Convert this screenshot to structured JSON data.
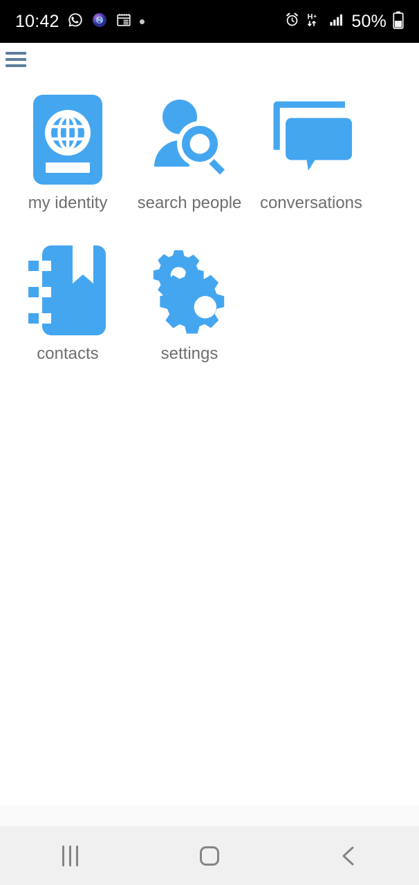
{
  "status_bar": {
    "time": "10:42",
    "battery_percent": "50%",
    "left_icons": [
      {
        "name": "whatsapp-icon",
        "label": "WhatsApp"
      },
      {
        "name": "app-notification-icon",
        "label": "App"
      },
      {
        "name": "calendar-icon",
        "label": "Calendar"
      },
      {
        "name": "notification-dot-icon",
        "label": "Notification"
      }
    ],
    "right_icons": [
      {
        "name": "alarm-clock-icon",
        "label": "Alarm"
      },
      {
        "name": "mobile-data-hplus-icon",
        "label": "H+"
      },
      {
        "name": "signal-bars-icon",
        "label": "Signal"
      },
      {
        "name": "battery-icon",
        "label": "Battery"
      }
    ],
    "background_color": "#000000",
    "text_color": "#ffffff"
  },
  "app_bar": {
    "menu_icon_name": "hamburger-menu-icon",
    "menu_color": "#5d7e9c"
  },
  "theme": {
    "accent_blue": "#45a6f0",
    "label_gray": "#6e6e6e",
    "page_background": "#ffffff",
    "nav_background": "#f0f0f0"
  },
  "grid": {
    "tiles": [
      {
        "id": "my-identity",
        "label": "my identity",
        "icon": "passport-globe-icon"
      },
      {
        "id": "search-people",
        "label": "search people",
        "icon": "person-search-icon"
      },
      {
        "id": "conversations",
        "label": "conversations",
        "icon": "chat-bubbles-icon"
      },
      {
        "id": "contacts",
        "label": "contacts",
        "icon": "address-book-icon"
      },
      {
        "id": "settings",
        "label": "settings",
        "icon": "gears-icon"
      }
    ]
  },
  "nav_bar": {
    "buttons": [
      {
        "id": "recents",
        "label": "Recents",
        "icon": "recents-icon"
      },
      {
        "id": "home",
        "label": "Home",
        "icon": "home-icon"
      },
      {
        "id": "back",
        "label": "Back",
        "icon": "back-chevron-icon"
      }
    ]
  }
}
